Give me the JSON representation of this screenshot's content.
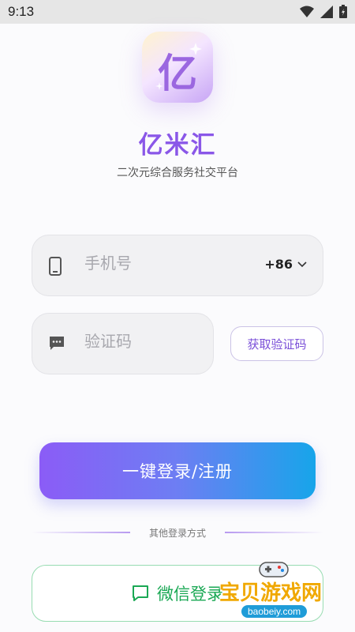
{
  "status_bar": {
    "time": "9:13"
  },
  "logo": {
    "glyph": "亿"
  },
  "app": {
    "name": "亿米汇",
    "tagline": "二次元综合服务社交平台"
  },
  "phone_field": {
    "placeholder": "手机号",
    "icon": "phone-icon",
    "country_code": "+86"
  },
  "code_field": {
    "placeholder": "验证码",
    "icon": "message-icon"
  },
  "get_code_button": {
    "label": "获取验证码"
  },
  "login_button": {
    "label": "一键登录/注册"
  },
  "other_methods": {
    "label": "其他登录方式"
  },
  "wechat_button": {
    "label": "微信登录",
    "icon": "chat-icon"
  },
  "watermark": {
    "text": "宝贝游戏网",
    "url": "baobeiy.com"
  },
  "colors": {
    "brand": "#8a57e8",
    "gradient_start": "#8b5cf6",
    "gradient_end": "#17a5ea",
    "wechat": "#1aa854",
    "statusbar_bg": "#e6e6e6"
  }
}
